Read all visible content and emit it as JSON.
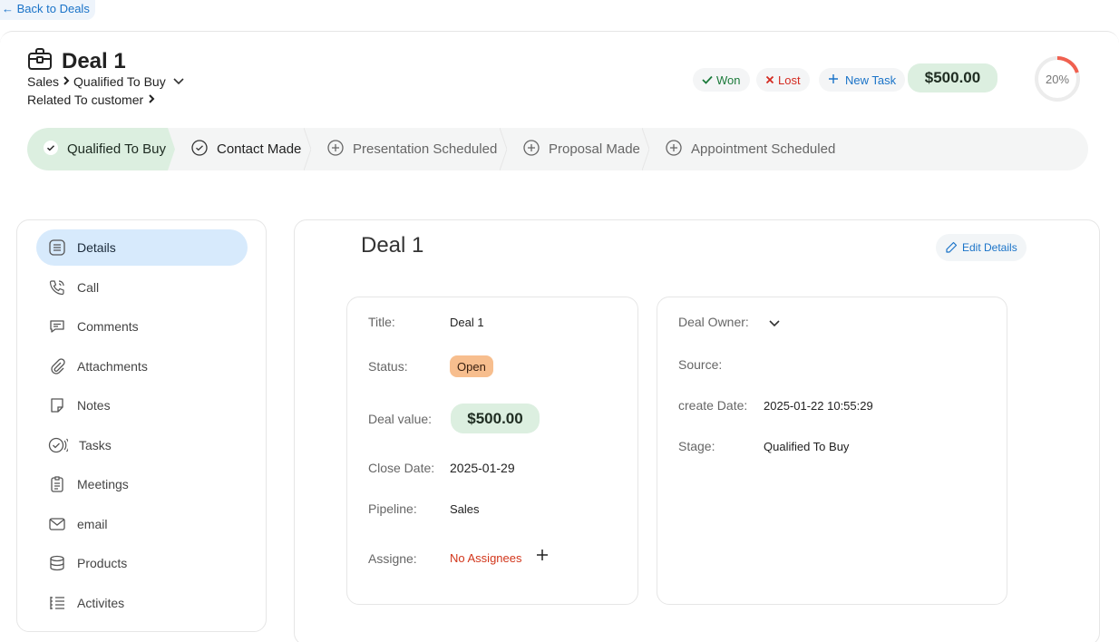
{
  "nav": {
    "back_label": "← Back to Deals"
  },
  "header": {
    "title": "Deal 1",
    "breadcrumb": {
      "pipeline": "Sales",
      "stage": "Qualified To Buy"
    },
    "related": "Related To customer",
    "won_label": "Won",
    "lost_label": "Lost",
    "new_task_label": "New Task",
    "amount": "$500.00",
    "progress_label": "20%",
    "progress_fraction": 0.2
  },
  "stages": [
    {
      "label": "Qualified To Buy",
      "state": "active"
    },
    {
      "label": "Contact Made",
      "state": "done"
    },
    {
      "label": "Presentation Scheduled",
      "state": "pending"
    },
    {
      "label": "Proposal Made",
      "state": "pending"
    },
    {
      "label": "Appointment Scheduled",
      "state": "pending"
    }
  ],
  "sidebar": {
    "items": [
      {
        "label": "Details",
        "icon": "details-icon"
      },
      {
        "label": "Call",
        "icon": "phone-icon"
      },
      {
        "label": "Comments",
        "icon": "comment-icon"
      },
      {
        "label": "Attachments",
        "icon": "paperclip-icon"
      },
      {
        "label": "Notes",
        "icon": "note-icon"
      },
      {
        "label": "Tasks",
        "icon": "tasks-icon"
      },
      {
        "label": "Meetings",
        "icon": "clipboard-icon"
      },
      {
        "label": "email",
        "icon": "mail-icon"
      },
      {
        "label": "Products",
        "icon": "database-icon"
      },
      {
        "label": "Activites",
        "icon": "list-icon"
      }
    ]
  },
  "main": {
    "title": "Deal 1",
    "edit_label": "Edit Details",
    "left": {
      "title_label": "Title:",
      "title_value": "Deal 1",
      "status_label": "Status:",
      "status_value": "Open",
      "value_label": "Deal value:",
      "value_value": "$500.00",
      "close_label": "Close Date:",
      "close_value": "2025-01-29",
      "pipeline_label": "Pipeline:",
      "pipeline_value": "Sales",
      "assignee_label": "Assigne:",
      "assignee_value": "No Assignees"
    },
    "right": {
      "owner_label": "Deal Owner:",
      "source_label": "Source:",
      "created_label": "create Date:",
      "created_value": "2025-01-22 10:55:29",
      "stage_label": "Stage:",
      "stage_value": "Qualified To Buy"
    }
  },
  "colors": {
    "accent_blue": "#1a73c8",
    "success_green_bg": "#dcefe0",
    "danger_red": "#d42a20",
    "status_open": "#f7be8e",
    "progress_ring": "#f0604f"
  }
}
